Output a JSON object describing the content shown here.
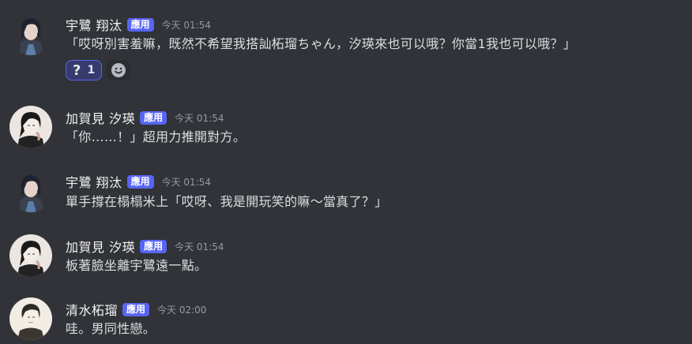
{
  "badge_label": "應用",
  "messages": [
    {
      "username": "宇鷺 翔汰",
      "timestamp": "今天 01:54",
      "avatar_icon": "dark-haired-character-avatar",
      "text": "「哎呀別害羞嘛，既然不希望我搭訕柘瑠ちゃん，汐瑛來也可以哦？你當1我也可以哦？」",
      "reactions": [
        {
          "emoji": "❓",
          "label": "?",
          "count": "1"
        }
      ]
    },
    {
      "username": "加賀見 汐瑛",
      "timestamp": "今天 01:54",
      "avatar_icon": "black-haired-character-avatar",
      "text": "「你……！」超用力推開對方。"
    },
    {
      "username": "宇鷺 翔汰",
      "timestamp": "今天 01:54",
      "avatar_icon": "dark-haired-character-avatar",
      "text": "單手撐在榻榻米上「哎呀、我是開玩笑的嘛～當真了？」"
    },
    {
      "username": "加賀見 汐瑛",
      "timestamp": "今天 01:54",
      "avatar_icon": "black-haired-character-avatar",
      "text": "板著臉坐離宇鷺遠一點。"
    },
    {
      "username": "清水柘瑠",
      "timestamp": "今天 02:00",
      "avatar_icon": "sketch-character-avatar",
      "text": "哇。男同性戀。"
    }
  ],
  "colors": {
    "background": "#313338",
    "badge": "#5865f2",
    "reaction_bg": "#373a6c",
    "reaction_border": "#5865f2"
  }
}
